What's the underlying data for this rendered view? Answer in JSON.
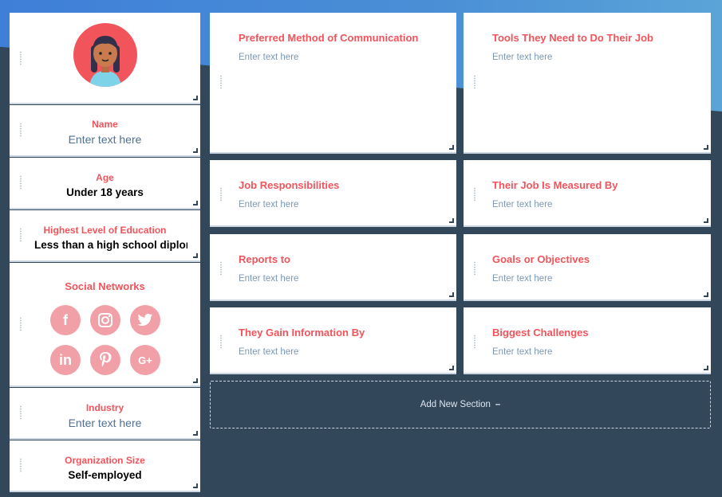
{
  "profile": {
    "name_label": "Name",
    "name_placeholder": "Enter text here",
    "age_label": "Age",
    "age_value": "Under 18 years",
    "education_label": "Highest Level of Education",
    "education_value": "Less than a high school diploma",
    "social_title": "Social Networks",
    "social_icons": [
      "facebook-icon",
      "instagram-icon",
      "twitter-icon",
      "linkedin-icon",
      "pinterest-icon",
      "google-plus-icon"
    ],
    "industry_label": "Industry",
    "industry_placeholder": "Enter text here",
    "org_size_label": "Organization Size",
    "org_size_value": "Self-employed"
  },
  "sections": [
    {
      "title": "Preferred Method of Communication",
      "placeholder": "Enter text here"
    },
    {
      "title": "Tools They Need to Do Their Job",
      "placeholder": "Enter text here"
    },
    {
      "title": "Job Responsibilities",
      "placeholder": "Enter text here"
    },
    {
      "title": "Their Job Is Measured By",
      "placeholder": "Enter text here"
    },
    {
      "title": "Reports to",
      "placeholder": "Enter text here"
    },
    {
      "title": "Goals or Objectives",
      "placeholder": "Enter text here"
    },
    {
      "title": "They Gain Information By",
      "placeholder": "Enter text here"
    },
    {
      "title": "Biggest Challenges",
      "placeholder": "Enter text here"
    }
  ],
  "add_section_label": "Add New Section",
  "add_section_icon": "–",
  "colors": {
    "accent": "#f2545b",
    "background": "#33475b",
    "social": "#f2a0a7"
  }
}
